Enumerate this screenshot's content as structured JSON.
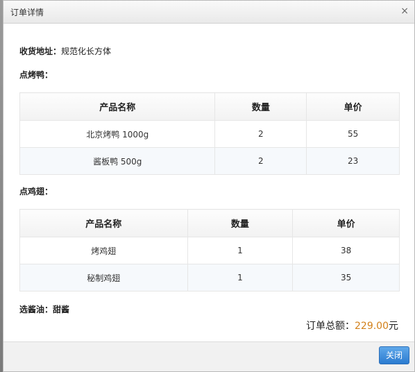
{
  "dialog": {
    "title": "订单详情",
    "close_symbol": "×"
  },
  "address": {
    "label": "收货地址：",
    "value": "规范化长方体"
  },
  "sections": [
    {
      "title": "点烤鸭：",
      "columns": [
        "产品名称",
        "数量",
        "单价"
      ],
      "rows": [
        [
          "北京烤鸭 1000g",
          "2",
          "55"
        ],
        [
          "酱板鸭 500g",
          "2",
          "23"
        ]
      ]
    },
    {
      "title": "点鸡翅：",
      "columns": [
        "产品名称",
        "数量",
        "单价"
      ],
      "rows": [
        [
          "烤鸡翅",
          "1",
          "38"
        ],
        [
          "秘制鸡翅",
          "1",
          "35"
        ]
      ]
    }
  ],
  "sauce": {
    "label": "选酱油：",
    "value": "甜酱"
  },
  "total": {
    "label": "订单总额：",
    "amount": "229.00",
    "unit": "元"
  },
  "footer": {
    "close_label": "关闭"
  },
  "colors": {
    "amount": "#d2801a",
    "button": "#2b7bd0"
  }
}
